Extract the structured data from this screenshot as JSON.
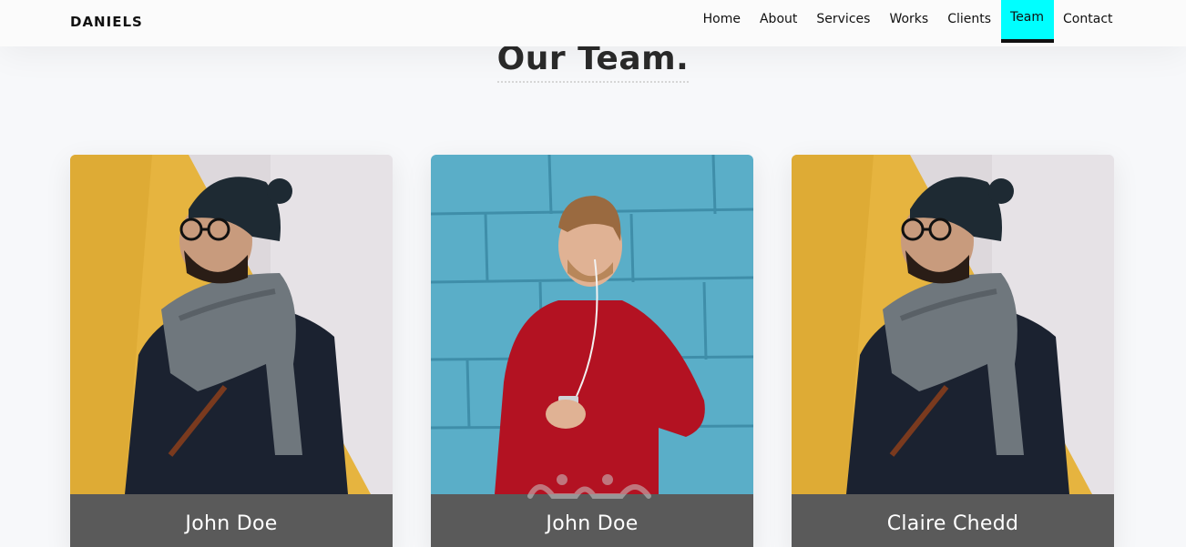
{
  "navbar": {
    "brand": "DANIELS",
    "items": [
      {
        "label": "Home",
        "active": false
      },
      {
        "label": "About",
        "active": false
      },
      {
        "label": "Services",
        "active": false
      },
      {
        "label": "Works",
        "active": false
      },
      {
        "label": "Clients",
        "active": false
      },
      {
        "label": "Team",
        "active": true
      },
      {
        "label": "Contact",
        "active": false
      }
    ],
    "active_color": "#00ffff"
  },
  "section": {
    "title": "Our Team."
  },
  "team": [
    {
      "name": "John Doe",
      "photo": "man-in-beanie-and-scarf"
    },
    {
      "name": "John Doe",
      "photo": "man-in-red-sweater-with-phone"
    },
    {
      "name": "Claire Chedd",
      "photo": "man-in-beanie-and-scarf"
    }
  ],
  "colors": {
    "card_footer": "#5a5a5a",
    "page_background": "#f7f8fa"
  }
}
